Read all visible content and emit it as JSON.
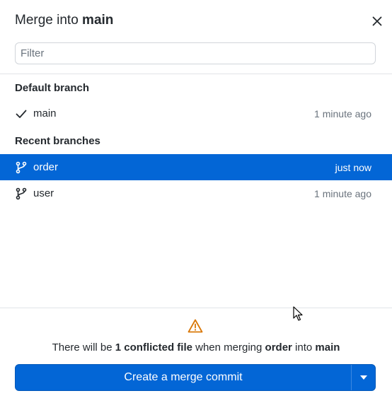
{
  "dialog": {
    "title_prefix": "Merge into ",
    "title_branch": "main",
    "close_label": "×"
  },
  "filter": {
    "placeholder": "Filter",
    "value": ""
  },
  "sections": {
    "default_label": "Default branch",
    "recent_label": "Recent branches"
  },
  "default_branches": [
    {
      "name": "main",
      "time": "1 minute ago",
      "icon": "check-icon"
    }
  ],
  "recent_branches": [
    {
      "name": "order",
      "time": "just now",
      "icon": "git-branch-icon",
      "selected": true
    },
    {
      "name": "user",
      "time": "1 minute ago",
      "icon": "git-branch-icon",
      "selected": false
    }
  ],
  "status": {
    "icon": "warning-icon",
    "text_1": "There will be ",
    "conflict_count": "1 conflicted file",
    "text_2": " when merging ",
    "source_branch": "order",
    "text_3": " into ",
    "target_branch": "main"
  },
  "merge_button": {
    "label": "Create a merge commit",
    "dropdown_icon": "caret-down-icon"
  },
  "colors": {
    "accent": "#0366d6",
    "warning": "#d97706",
    "muted": "#6a737d"
  }
}
